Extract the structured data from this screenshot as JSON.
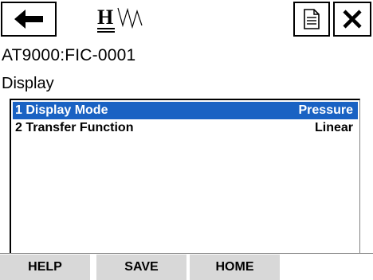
{
  "toolbar": {
    "back_icon": "left-arrow-icon",
    "logo_text": "H",
    "logo_icon": "hart-wave-logo",
    "document_icon": "document-icon",
    "close_icon": "close-x-icon"
  },
  "device_tag": "AT9000:FIC-0001",
  "menu_title": "Display",
  "menu_items": [
    {
      "label": "1 Display Mode",
      "value": "Pressure",
      "selected": true
    },
    {
      "label": "2 Transfer Function",
      "value": "Linear",
      "selected": false
    }
  ],
  "soft_keys": [
    "HELP",
    "SAVE",
    "HOME",
    ""
  ],
  "colors": {
    "selection": "#1a62c3",
    "soft_key_bg": "#d8d8d8"
  }
}
